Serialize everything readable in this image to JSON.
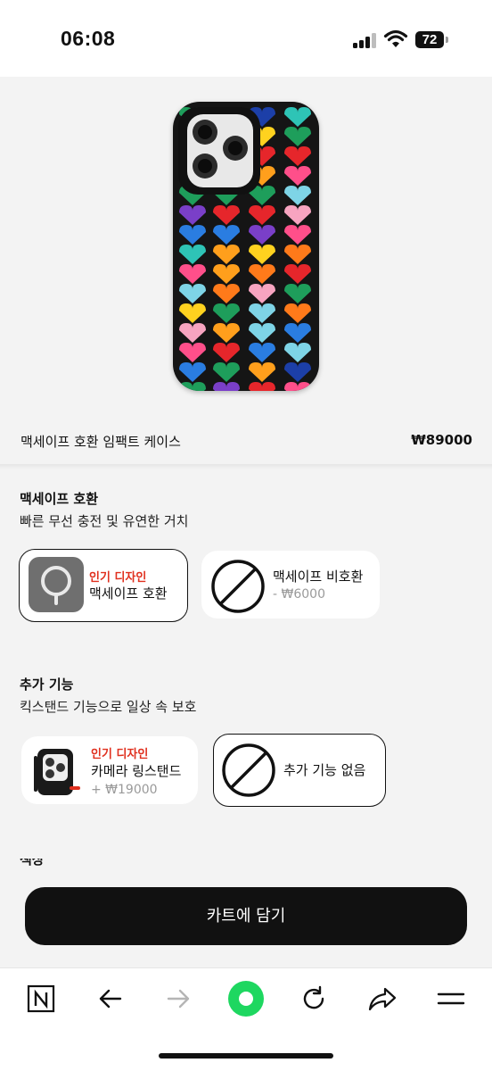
{
  "status_bar": {
    "time": "06:08",
    "battery": "72"
  },
  "product": {
    "name": "맥세이프 호환 임팩트 케이스",
    "price": "₩89000"
  },
  "sections": {
    "magsafe": {
      "title": "맥세이프 호환",
      "subtitle": "빠른 무선 충전 및 유연한 거치",
      "options": [
        {
          "badge": "인기 디자인",
          "label": "맥세이프 호환",
          "selected": true
        },
        {
          "label": "맥세이프 비호환",
          "price": "- ₩6000",
          "selected": false
        }
      ]
    },
    "extra": {
      "title": "추가 기능",
      "subtitle": "킥스탠드 기능으로 일상 속 보호",
      "options": [
        {
          "badge": "인기 디자인",
          "label": "카메라 링스탠드",
          "price": "+ ₩19000",
          "selected": false
        },
        {
          "label": "추가 기능 없음",
          "selected": true
        }
      ]
    },
    "next_partial": "색상"
  },
  "cart": {
    "button_label": "카트에 담기"
  },
  "browser_toolbar": {
    "items": [
      "naver-n-icon",
      "back-arrow-icon",
      "forward-arrow-icon",
      "green-dot-icon",
      "refresh-icon",
      "share-icon",
      "menu-icon"
    ]
  },
  "colors": {
    "accent_red": "#e0301e",
    "cart_button": "#111111",
    "green_button": "#1ed760"
  }
}
